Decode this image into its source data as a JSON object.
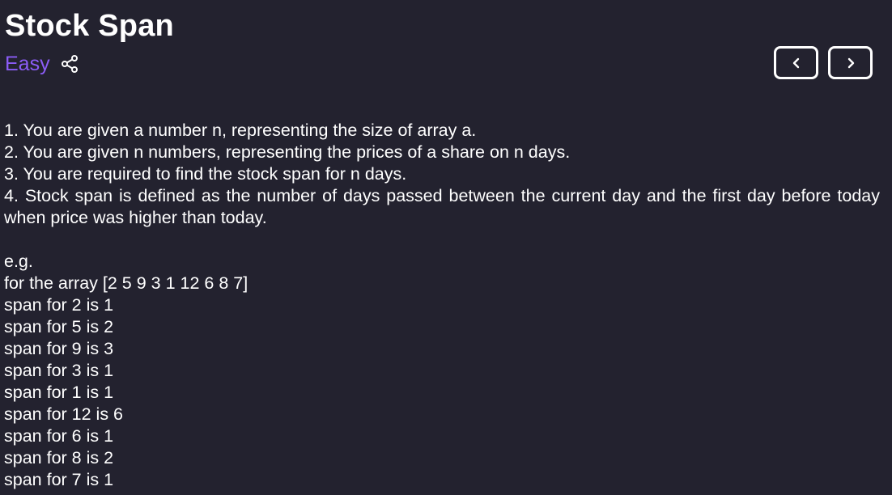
{
  "problem": {
    "title": "Stock Span",
    "difficulty": "Easy"
  },
  "icons": {
    "share": "share-icon",
    "prev": "chevron-left-icon",
    "next": "chevron-right-icon"
  },
  "colors": {
    "background": "#23222f",
    "difficulty": "#8b5cf6",
    "text": "#ffffff"
  },
  "description": {
    "points": [
      "1. You are given a number n, representing the size of array a.",
      "2. You are given n numbers, representing the prices of a share on n days.",
      "3. You are required to find the stock span for n days.",
      "4. Stock span is defined as the number of days passed between the current day and the first day before today when price was higher than today."
    ],
    "example": [
      "e.g.",
      "for the array [2 5 9 3 1 12 6 8 7]",
      "span for 2 is 1",
      "span for 5 is 2",
      "span for 9 is 3",
      "span for 3 is 1",
      "span for 1 is 1",
      "span for 12 is 6",
      "span for 6 is 1",
      "span for 8 is 2",
      "span for 7 is 1"
    ]
  }
}
